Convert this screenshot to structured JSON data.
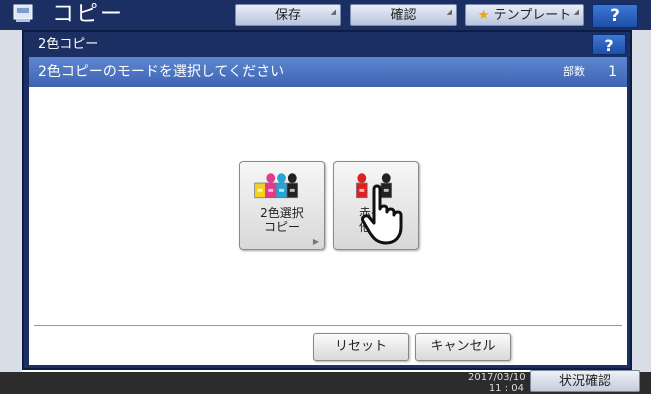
{
  "app": {
    "title": "コピー"
  },
  "top_tabs": {
    "save": "保存",
    "confirm": "確認",
    "template": "テンプレート",
    "help": "?"
  },
  "dialog": {
    "title": "2色コピー",
    "help": "?",
    "instruction": "2色コピーのモードを選択してください",
    "copies_label": "部数",
    "copies_value": "1"
  },
  "modes": {
    "two_color_select": {
      "line1": "2色選択",
      "line2": "コピー"
    },
    "red_black": {
      "line1": "赤→赤",
      "line2": "他→黒"
    }
  },
  "buttons": {
    "reset": "リセット",
    "cancel": "キャンセル"
  },
  "bottom": {
    "date": "2017/03/10",
    "time": "11 : 04",
    "status": "状況確認"
  },
  "colors": {
    "header_bg": "#1c2f63",
    "instruction_bar": "#4a72c0",
    "help_button": "#2a5fc0",
    "ink_yellow": "#f2d21e",
    "ink_magenta": "#e23a8c",
    "ink_cyan": "#24a4d8",
    "ink_black": "#222222",
    "ink_red": "#e02020"
  },
  "icons": [
    "copier-icon",
    "star-icon",
    "ink-tube-icon",
    "hand-pointer-icon"
  ]
}
